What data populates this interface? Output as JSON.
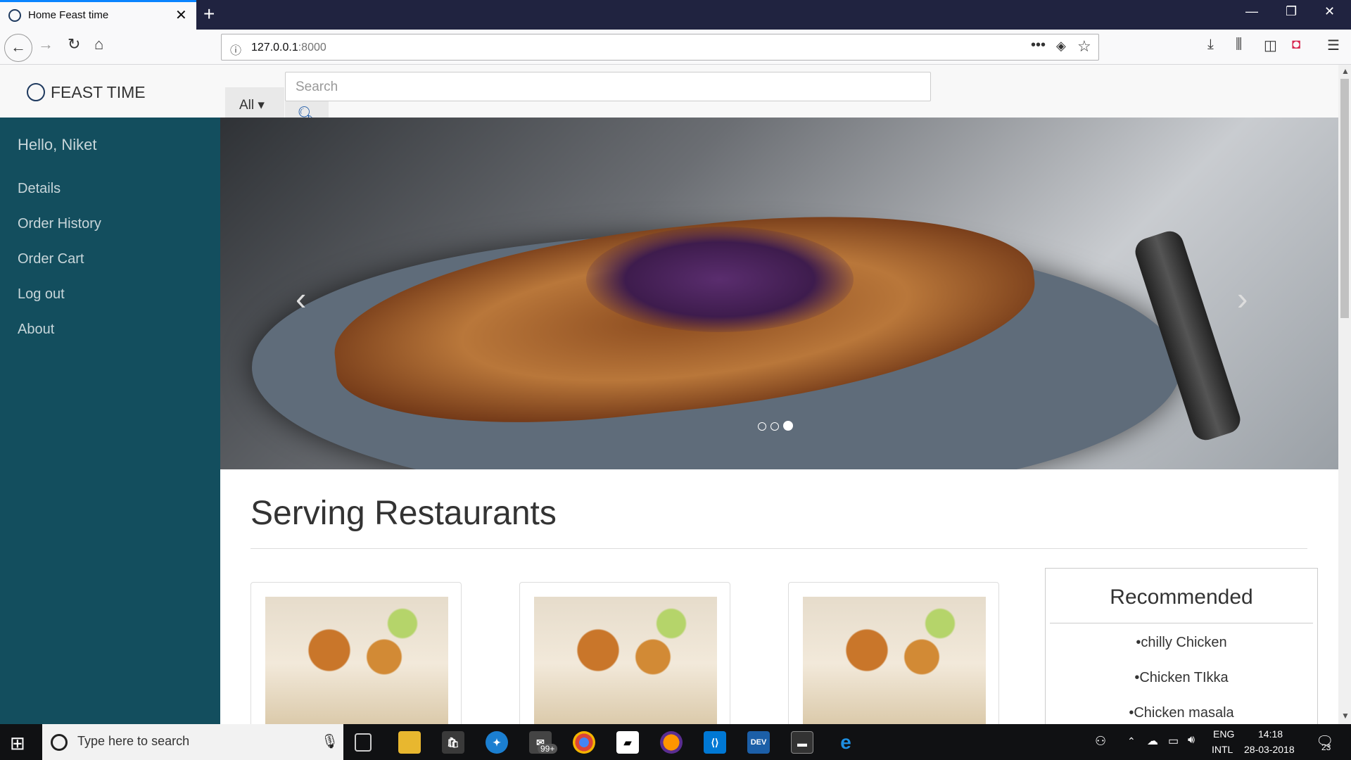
{
  "browser": {
    "tab_title": "Home Feast time",
    "url_host": "127.0.0.1",
    "url_port": ":8000"
  },
  "site": {
    "brand": "FEAST TIME",
    "search_category": "All",
    "search_placeholder": "Search"
  },
  "sidebar": {
    "greeting": "Hello, Niket",
    "items": [
      {
        "label": "Details"
      },
      {
        "label": "Order History"
      },
      {
        "label": "Order Cart"
      },
      {
        "label": "Log out"
      },
      {
        "label": "About"
      }
    ]
  },
  "carousel": {
    "slide_count": 3,
    "active_slide": 3
  },
  "main": {
    "section_title": "Serving Restaurants",
    "restaurant_cards": 3
  },
  "recommended": {
    "title": "Recommended",
    "items": [
      "chilly Chicken",
      "Chicken TIkka",
      "Chicken masala"
    ]
  },
  "taskbar": {
    "search_placeholder": "Type here to search",
    "mail_badge": "99+",
    "language": "ENG",
    "layout": "INTL",
    "time": "14:18",
    "date": "28-03-2018",
    "notification_count": "23"
  }
}
